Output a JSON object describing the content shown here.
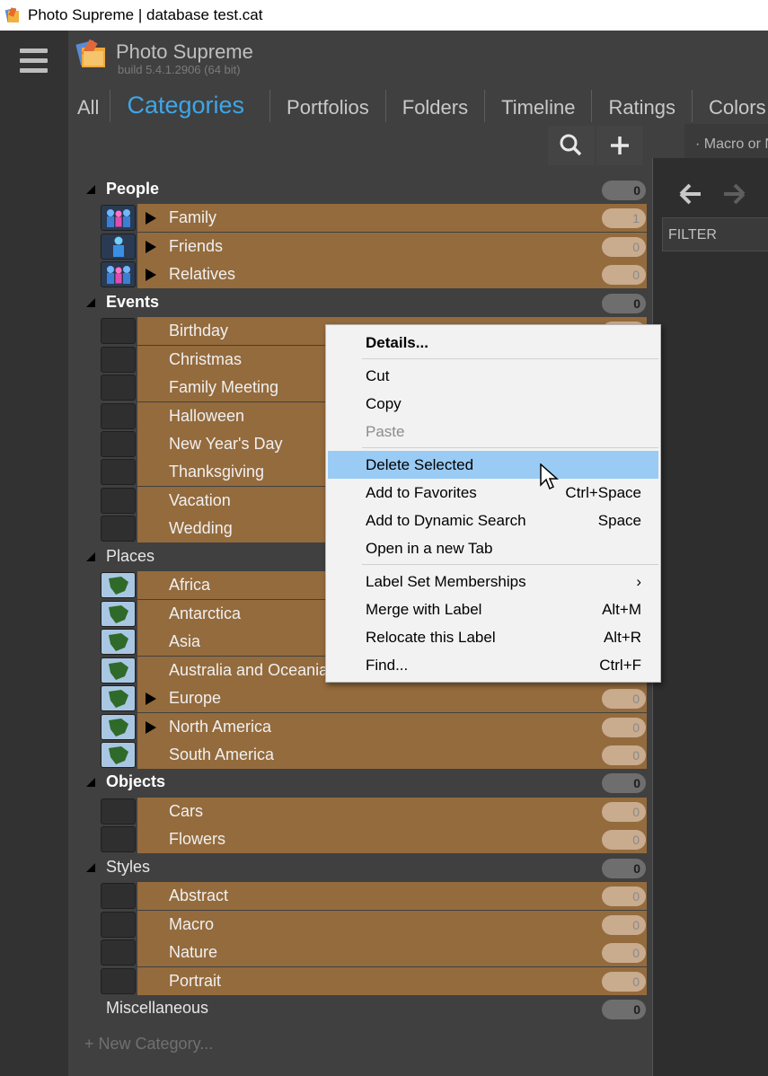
{
  "window": {
    "title": "Photo Supreme | database test.cat"
  },
  "app": {
    "name": "Photo Supreme",
    "build": "build 5.4.1.2906 (64 bit)"
  },
  "nav": {
    "tabs": [
      {
        "label": "All"
      },
      {
        "label": "Categories",
        "active": true
      },
      {
        "label": "Portfolios"
      },
      {
        "label": "Folders"
      },
      {
        "label": "Timeline"
      },
      {
        "label": "Ratings"
      },
      {
        "label": "Colors"
      }
    ]
  },
  "right_panel": {
    "tab_label": "· Macro or N",
    "filter_label": "FILTER"
  },
  "groups": [
    {
      "label": "People",
      "bold": true,
      "count": "0",
      "items": [
        {
          "label": "Family",
          "count": "1",
          "expandable": true,
          "thumb": "people-icon"
        },
        {
          "label": "Friends",
          "count": "0",
          "expandable": true,
          "thumb": "person-icon"
        },
        {
          "label": "Relatives",
          "count": "0",
          "expandable": true,
          "thumb": "people-icon"
        }
      ]
    },
    {
      "label": "Events",
      "bold": true,
      "count": "0",
      "items": [
        {
          "label": "Birthday",
          "count": "0"
        },
        {
          "label": "Christmas",
          "count": "0"
        },
        {
          "label": "Family Meeting",
          "count": "0"
        },
        {
          "label": "Halloween",
          "count": "0"
        },
        {
          "label": "New Year's Day",
          "count": "0"
        },
        {
          "label": "Thanksgiving",
          "count": "0"
        },
        {
          "label": "Vacation",
          "count": "0"
        },
        {
          "label": "Wedding",
          "count": "0"
        }
      ]
    },
    {
      "label": "Places",
      "bold": false,
      "count": "0",
      "items": [
        {
          "label": "Africa",
          "count": "0",
          "thumb": "map-icon"
        },
        {
          "label": "Antarctica",
          "count": "0",
          "thumb": "map-icon"
        },
        {
          "label": "Asia",
          "count": "0",
          "thumb": "map-icon"
        },
        {
          "label": "Australia and Oceania",
          "count": "0",
          "thumb": "map-icon"
        },
        {
          "label": "Europe",
          "count": "0",
          "expandable": true,
          "thumb": "map-icon"
        },
        {
          "label": "North America",
          "count": "0",
          "expandable": true,
          "thumb": "map-icon"
        },
        {
          "label": "South America",
          "count": "0",
          "thumb": "map-icon"
        }
      ]
    },
    {
      "label": "Objects",
      "bold": true,
      "count": "0",
      "items": [
        {
          "label": "Cars",
          "count": "0"
        },
        {
          "label": "Flowers",
          "count": "0"
        }
      ]
    },
    {
      "label": "Styles",
      "bold": false,
      "count": "0",
      "items": [
        {
          "label": "Abstract",
          "count": "0"
        },
        {
          "label": "Macro",
          "count": "0"
        },
        {
          "label": "Nature",
          "count": "0"
        },
        {
          "label": "Portrait",
          "count": "0"
        }
      ]
    },
    {
      "label": "Miscellaneous",
      "bold": false,
      "count": "0",
      "items": []
    }
  ],
  "new_category": "New Category...",
  "context_menu": {
    "items": [
      {
        "label": "Details...",
        "shortcut": "",
        "bold": true
      },
      {
        "separator": true
      },
      {
        "label": "Cut",
        "shortcut": ""
      },
      {
        "label": "Copy",
        "shortcut": ""
      },
      {
        "label": "Paste",
        "shortcut": "",
        "disabled": true
      },
      {
        "separator": true
      },
      {
        "label": "Delete Selected",
        "shortcut": "",
        "highlighted": true
      },
      {
        "label": "Add to Favorites",
        "shortcut": "Ctrl+Space"
      },
      {
        "label": "Add to Dynamic Search",
        "shortcut": "Space"
      },
      {
        "label": "Open in a new Tab",
        "shortcut": ""
      },
      {
        "separator": true
      },
      {
        "label": "Label Set Memberships",
        "shortcut": "›"
      },
      {
        "label": "Merge with Label",
        "shortcut": "Alt+M"
      },
      {
        "label": "Relocate this Label",
        "shortcut": "Alt+R"
      },
      {
        "label": "Find...",
        "shortcut": "Ctrl+F"
      }
    ]
  },
  "colors": {
    "accent": "#3ea6e8",
    "item_bar": "#946b3d",
    "menu_highlight": "#99cbf4"
  }
}
